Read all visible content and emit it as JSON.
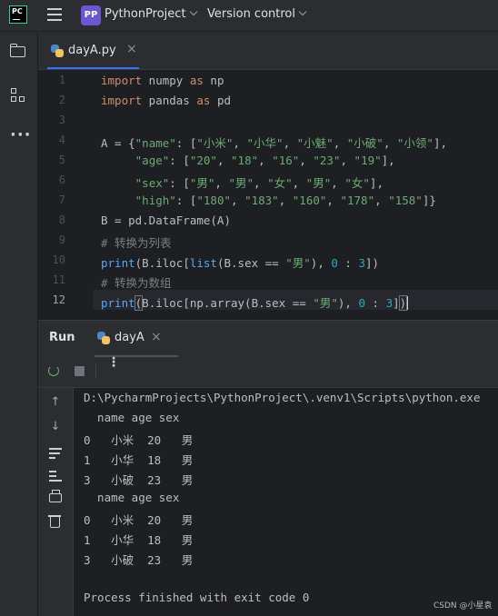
{
  "titlebar": {
    "logo_text": "PC",
    "project_badge": "PP",
    "project_name": "PythonProject",
    "version_control": "Version control"
  },
  "editor": {
    "tab": {
      "filename": "dayA.py",
      "close": "×"
    },
    "line_numbers": [
      "1",
      "2",
      "3",
      "4",
      "5",
      "6",
      "7",
      "8",
      "9",
      "10",
      "11",
      "12"
    ],
    "current_line": 12,
    "code": {
      "l1": {
        "kw1": "import",
        "t1": " numpy ",
        "kw2": "as",
        "t2": " np"
      },
      "l2": {
        "kw1": "import",
        "t1": " pandas ",
        "kw2": "as",
        "t2": " pd"
      },
      "l4": {
        "t1": "A = {",
        "k": "\"name\"",
        "t2": ": [",
        "s1": "\"小米\"",
        "s2": "\"小华\"",
        "s3": "\"小魅\"",
        "s4": "\"小破\"",
        "s5": "\"小领\"",
        "t3": "],"
      },
      "l5": {
        "t0": "     ",
        "k": "\"age\"",
        "t2": ": [",
        "s1": "\"20\"",
        "s2": "\"18\"",
        "s3": "\"16\"",
        "s4": "\"23\"",
        "s5": "\"19\"",
        "t3": "],"
      },
      "l6": {
        "t0": "     ",
        "k": "\"sex\"",
        "t2": ": [",
        "s1": "\"男\"",
        "s2": "\"男\"",
        "s3": "\"女\"",
        "s4": "\"男\"",
        "s5": "\"女\"",
        "t3": "],"
      },
      "l7": {
        "t0": "     ",
        "k": "\"high\"",
        "t2": ": [",
        "s1": "\"180\"",
        "s2": "\"183\"",
        "s3": "\"160\"",
        "s4": "\"178\"",
        "s5": "\"158\"",
        "t3": "]}"
      },
      "l8": {
        "t1": "B = pd.DataFrame(A)"
      },
      "l9": {
        "c": "# 转换为列表"
      },
      "l10": {
        "f": "print",
        "t1": "(B.iloc[",
        "f2": "list",
        "t2": "(B.sex == ",
        "s": "\"男\"",
        "t3": "), ",
        "n1": "0",
        "t4": " : ",
        "n2": "3",
        "t5": "])"
      },
      "l11": {
        "c": "# 转换为数组"
      },
      "l12": {
        "f": "print",
        "p1": "(",
        "t1": "B.iloc[np.array(B.sex == ",
        "s": "\"男\"",
        "t3": "), ",
        "n1": "0",
        "t4": " : ",
        "n2": "3",
        "t5": "]",
        "p2": ")"
      }
    },
    "sep": ", "
  },
  "run": {
    "title": "Run",
    "tab": "dayA",
    "close": "×",
    "kebab": "⋮"
  },
  "console": {
    "lines": [
      "D:\\PycharmProjects\\PythonProject\\.venv1\\Scripts\\python.exe",
      "  name age sex",
      "0   小米  20   男",
      "1   小华  18   男",
      "3   小破  23   男",
      "  name age sex",
      "0   小米  20   男",
      "1   小华  18   男",
      "3   小破  23   男",
      "",
      "Process finished with exit code 0"
    ]
  },
  "icons": [
    "pycharm-logo",
    "menu-icon",
    "folder-icon",
    "structure-icon",
    "more-icon",
    "python-file-icon",
    "rerun-icon",
    "stop-icon",
    "up-arrow-icon",
    "down-arrow-icon",
    "soft-wrap-icon",
    "scroll-to-end-icon",
    "print-icon",
    "trash-icon"
  ],
  "watermark": "CSDN @小星袁"
}
